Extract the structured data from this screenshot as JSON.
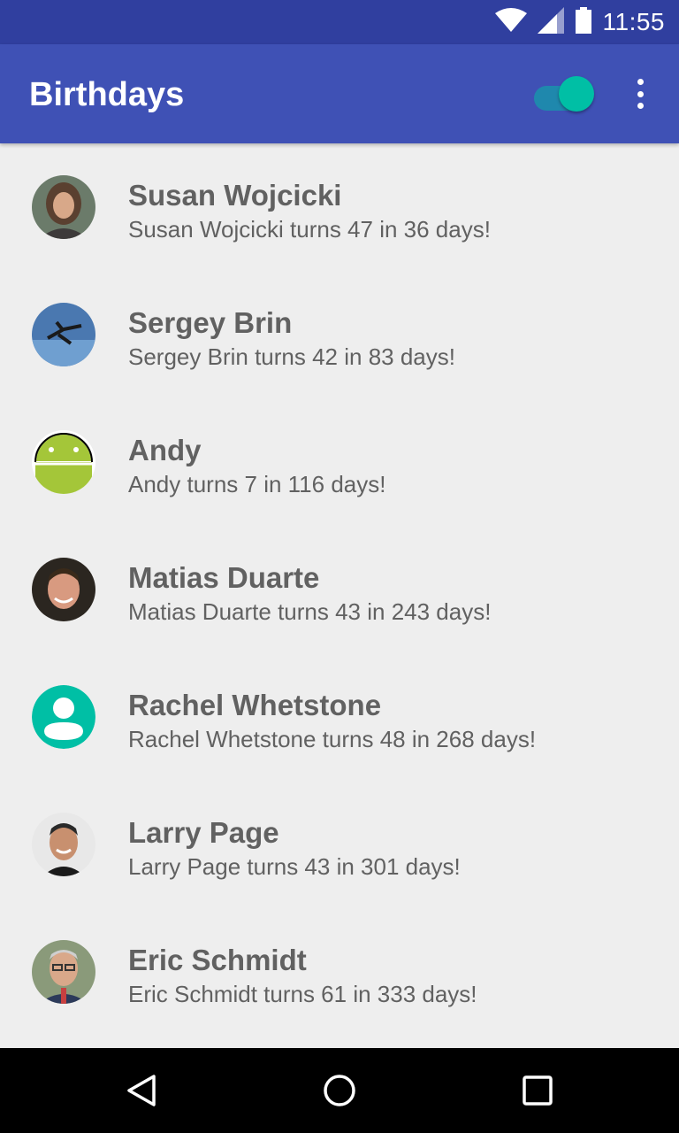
{
  "status_bar": {
    "time": "11:55",
    "icons": [
      "wifi-icon",
      "cell-signal-icon",
      "battery-icon"
    ]
  },
  "app_bar": {
    "title": "Birthdays",
    "toggle_on": true,
    "menu_icon": "more-vert-icon"
  },
  "colors": {
    "primary": "#3f51b5",
    "primary_dark": "#303f9f",
    "accent": "#00bfa5",
    "background": "#eeeeee",
    "text": "#616161"
  },
  "contacts": [
    {
      "name": "Susan Wojcicki",
      "subtitle": "Susan Wojcicki turns 47 in 36 days!",
      "avatar": "photo"
    },
    {
      "name": "Sergey Brin",
      "subtitle": "Sergey Brin turns 42 in 83 days!",
      "avatar": "photo"
    },
    {
      "name": "Andy",
      "subtitle": "Andy turns 7 in 116 days!",
      "avatar": "android-icon"
    },
    {
      "name": "Matias Duarte",
      "subtitle": "Matias Duarte turns 43 in 243 days!",
      "avatar": "photo"
    },
    {
      "name": "Rachel Whetstone",
      "subtitle": "Rachel Whetstone turns 48 in 268 days!",
      "avatar": "default-person-icon"
    },
    {
      "name": "Larry Page",
      "subtitle": "Larry Page turns 43 in 301 days!",
      "avatar": "photo"
    },
    {
      "name": "Eric Schmidt",
      "subtitle": "Eric Schmidt turns 61 in 333 days!",
      "avatar": "photo"
    }
  ],
  "nav_bar": {
    "buttons": [
      "back-icon",
      "home-icon",
      "recents-icon"
    ]
  }
}
